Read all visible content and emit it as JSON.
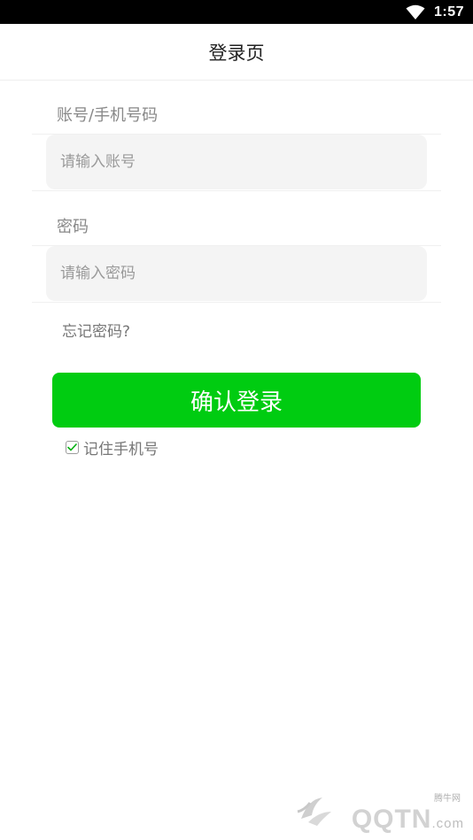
{
  "status_bar": {
    "time": "1:57",
    "wifi_icon": "wifi-icon"
  },
  "header": {
    "title": "登录页"
  },
  "account": {
    "label": "账号/手机号码",
    "placeholder": "请输入账号",
    "value": ""
  },
  "password": {
    "label": "密码",
    "placeholder": "请输入密码",
    "value": ""
  },
  "forgot_link": "忘记密码?",
  "login_button": "确认登录",
  "remember": {
    "label": "记住手机号",
    "checked": true,
    "icon": "checkbox-checked-icon"
  },
  "watermark": {
    "site_name": "腾牛网",
    "brand": "QQTN",
    "suffix": ".com"
  },
  "colors": {
    "accent": "#00cc11",
    "input_bg": "#f4f4f4",
    "status_bar": "#000000"
  }
}
